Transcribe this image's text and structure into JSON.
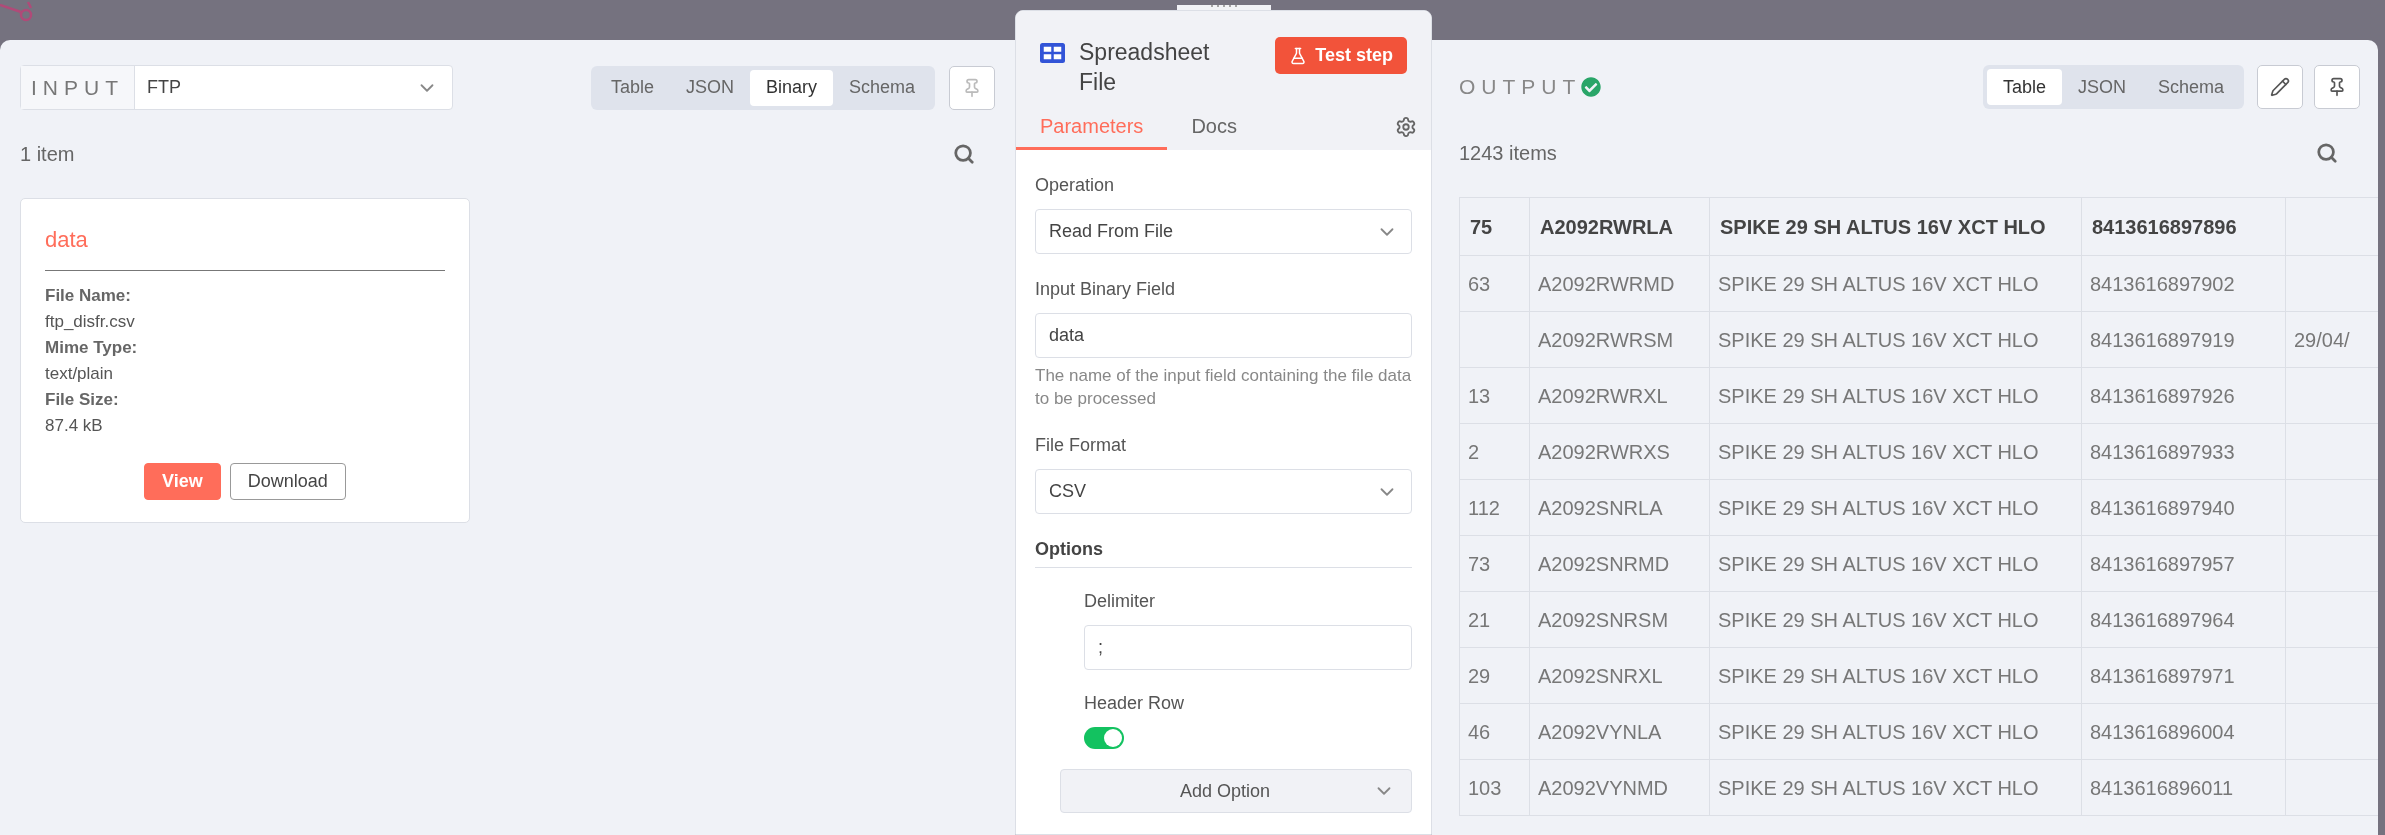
{
  "input_panel": {
    "label": "INPUT",
    "source": "FTP",
    "view_tabs": [
      {
        "label": "Table",
        "selected": false
      },
      {
        "label": "JSON",
        "selected": false
      },
      {
        "label": "Binary",
        "selected": true
      },
      {
        "label": "Schema",
        "selected": false
      }
    ],
    "item_count": "1 item",
    "binary_card": {
      "title": "data",
      "fields": [
        {
          "label": "File Name:",
          "value": "ftp_disfr.csv"
        },
        {
          "label": "Mime Type:",
          "value": "text/plain"
        },
        {
          "label": "File Size:",
          "value": "87.4 kB"
        }
      ],
      "buttons": [
        {
          "label": "View",
          "kind": "primary"
        },
        {
          "label": "Download",
          "kind": "secondary"
        }
      ]
    }
  },
  "node_panel": {
    "title": "Spreadsheet File",
    "test_button": "Test step",
    "tabs": [
      {
        "label": "Parameters",
        "selected": true
      },
      {
        "label": "Docs",
        "selected": false
      }
    ],
    "fields": [
      {
        "kind": "select",
        "label": "Operation",
        "value": "Read From File"
      },
      {
        "kind": "text",
        "label": "Input Binary Field",
        "value": "data",
        "hint": "The name of the input field containing the file data to be processed"
      },
      {
        "kind": "select",
        "label": "File Format",
        "value": "CSV"
      }
    ],
    "options": {
      "title": "Options",
      "items": [
        {
          "kind": "text",
          "label": "Delimiter",
          "value": ";"
        },
        {
          "kind": "toggle",
          "label": "Header Row",
          "on": true
        }
      ],
      "add_button": "Add Option"
    }
  },
  "output_panel": {
    "label": "OUTPUT",
    "success": true,
    "view_tabs": [
      {
        "label": "Table",
        "selected": true
      },
      {
        "label": "JSON",
        "selected": false
      },
      {
        "label": "Schema",
        "selected": false
      }
    ],
    "item_count": "1243 items",
    "table": {
      "columns": [
        "75",
        "A2092RWRLA",
        "SPIKE 29 SH ALTUS 16V XCT HLO",
        "8413616897896",
        null
      ],
      "rows": [
        [
          "63",
          "A2092RWRMD",
          "SPIKE 29 SH ALTUS 16V XCT HLO",
          "8413616897902",
          null
        ],
        [
          null,
          "A2092RWRSM",
          "SPIKE 29 SH ALTUS 16V XCT HLO",
          "8413616897919",
          "29/04/"
        ],
        [
          "13",
          "A2092RWRXL",
          "SPIKE 29 SH ALTUS 16V XCT HLO",
          "8413616897926",
          null
        ],
        [
          "2",
          "A2092RWRXS",
          "SPIKE 29 SH ALTUS 16V XCT HLO",
          "8413616897933",
          null
        ],
        [
          "112",
          "A2092SNRLA",
          "SPIKE 29 SH ALTUS 16V XCT HLO",
          "8413616897940",
          null
        ],
        [
          "73",
          "A2092SNRMD",
          "SPIKE 29 SH ALTUS 16V XCT HLO",
          "8413616897957",
          null
        ],
        [
          "21",
          "A2092SNRSM",
          "SPIKE 29 SH ALTUS 16V XCT HLO",
          "8413616897964",
          null
        ],
        [
          "29",
          "A2092SNRXL",
          "SPIKE 29 SH ALTUS 16V XCT HLO",
          "8413616897971",
          null
        ],
        [
          "46",
          "A2092VYNLA",
          "SPIKE 29 SH ALTUS 16V XCT HLO",
          "8413616896004",
          null
        ],
        [
          "103",
          "A2092VYNMD",
          "SPIKE 29 SH ALTUS 16V XCT HLO",
          "8413616896011",
          null
        ]
      ]
    }
  }
}
